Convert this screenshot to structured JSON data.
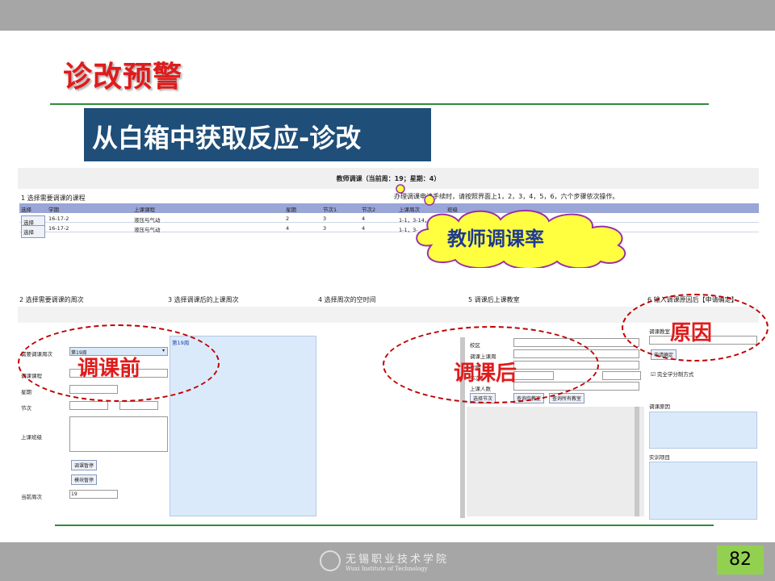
{
  "slide": {
    "title": "诊改预警",
    "banner": "从白箱中获取反应-诊改",
    "page_number": "82",
    "footer_cn": "无锡职业技术学院",
    "footer_en": "Wuxi Institute of Technology"
  },
  "app": {
    "window_title": "教师调课（当前周：19；星期：4）",
    "step1": "1 选择需要调课的课程",
    "step_info": "办理调课申请手续时，请按照界面上1，2，3，4，5，6，六个步骤依次操作。",
    "columns": [
      "选择",
      "学期",
      "上课课程",
      "星期",
      "节次1",
      "节次2",
      "上课周次",
      "班级"
    ],
    "rows": [
      {
        "select": "选择",
        "term": "16-17-2",
        "course": "液压与气动",
        "weekday": "2",
        "p1": "3",
        "p2": "4",
        "weeks": "1-1，3-14，"
      },
      {
        "select": "选择",
        "term": "16-17-2",
        "course": "液压与气动",
        "weekday": "4",
        "p1": "3",
        "p2": "4",
        "weeks": "1-1，3-"
      }
    ],
    "steps": [
      "2 选择需要调课的周次",
      "3 选择调课后的上课周次",
      "4 选择周次的空时间",
      "5 调课后上课教室",
      "6 输入调课原因后【申请确定】"
    ],
    "left_form": {
      "week_label": "需要调课周次",
      "week_value": "第19周",
      "course_label": "调课课程",
      "weekday_label": "星期",
      "period_label": "节次",
      "class_label": "上课班级",
      "pause_btn": "调课暂停",
      "module_btn": "模块暂停",
      "current_week_label": "当前周次",
      "current_week_value": "19"
    },
    "week_list_item": "第19周",
    "room_form": {
      "campus": "校区",
      "course": "调课上课周",
      "weekday": "星期",
      "period": "节次",
      "count": "上课人数",
      "select_period_btn": "选择节次",
      "free_room_btn": "查询空教室",
      "all_room_btn": "查询所有教室"
    },
    "reason_form": {
      "classroom_label": "调课教室",
      "apply_btn": "申请确定",
      "checkbox_label": "完全学分制方式",
      "reason_label": "调课原因",
      "item_label": "实训项目"
    }
  },
  "callouts": {
    "cloud": "教师调课率",
    "before": "调课前",
    "after": "调课后",
    "reason": "原因"
  }
}
